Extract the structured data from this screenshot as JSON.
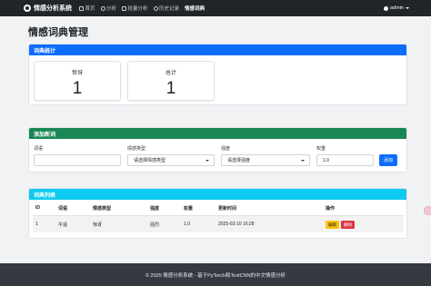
{
  "navbar": {
    "brand": "情感分析系统",
    "links": [
      {
        "label": "首页",
        "icon": "home-icon"
      },
      {
        "label": "分析",
        "icon": "search-icon"
      },
      {
        "label": "批量分析",
        "icon": "list-icon"
      },
      {
        "label": "历史记录",
        "icon": "clock-icon"
      },
      {
        "label": "情感词典",
        "icon": ""
      }
    ],
    "user": "admin"
  },
  "page": {
    "title": "情感词典管理"
  },
  "stats": {
    "header": "词典统计",
    "items": [
      {
        "label": "惊讶",
        "value": "1"
      },
      {
        "label": "总计",
        "value": "1"
      }
    ]
  },
  "add_form": {
    "header": "添加新词",
    "word_label": "词语",
    "word_value": "",
    "type_label": "情感类型",
    "type_value": "请选择情感类型",
    "strength_label": "强度",
    "strength_value": "请选择强度",
    "weight_label": "权重",
    "weight_value": "1.0",
    "submit_label": "添加"
  },
  "list": {
    "header": "词典列表",
    "columns": [
      "ID",
      "词语",
      "情感类型",
      "强度",
      "权重",
      "更新时间",
      "操作"
    ],
    "rows": [
      {
        "id": "1",
        "word": "牛逼",
        "type": "惊讶",
        "strength": "强烈",
        "weight": "1.0",
        "updated": "2025-03-10 16:28",
        "edit": "编辑",
        "delete": "删除"
      }
    ]
  },
  "footer": {
    "text": "© 2025 情感分析系统 - 基于PyTorch和TextCNN的中文情感分析"
  },
  "colors": {
    "navbar": "#212529",
    "primary": "#0d6efd",
    "success": "#198754",
    "info": "#0dcaf0",
    "warning": "#ffc107",
    "danger": "#dc3545"
  }
}
